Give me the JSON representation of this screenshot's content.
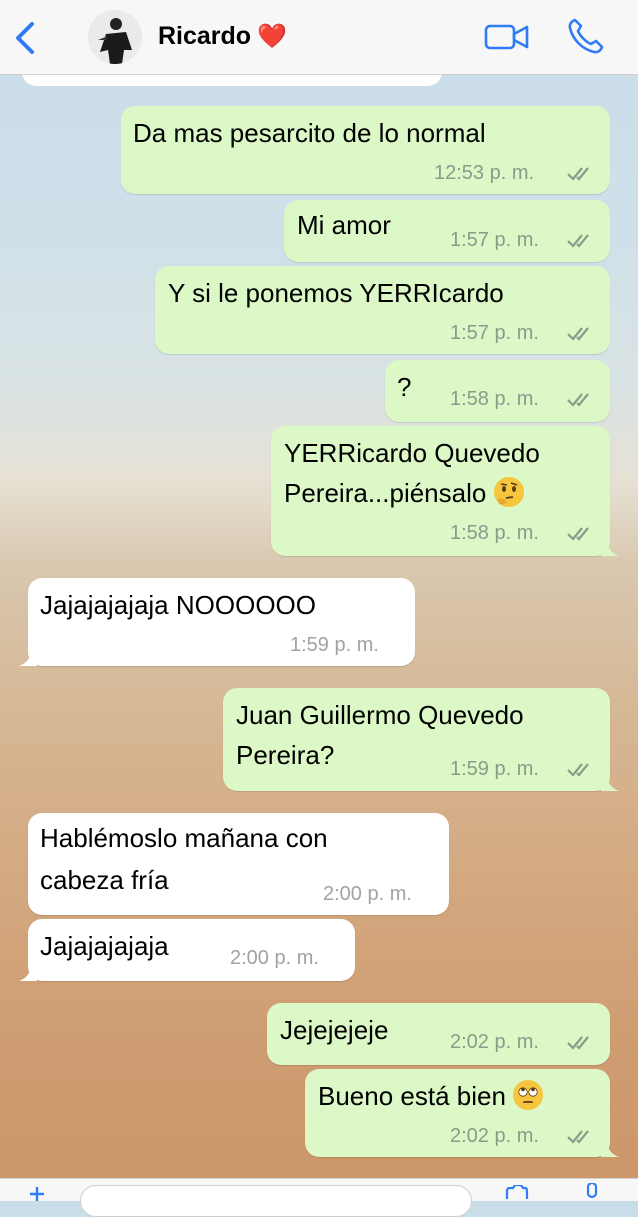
{
  "header": {
    "contact_name": "Ricardo",
    "heart": "❤️"
  },
  "messages": [
    {
      "direction": "out",
      "text": "Da mas pesarcito de lo normal",
      "time": "12:53 p. m.",
      "status": "read"
    },
    {
      "direction": "out",
      "text": "Mi amor",
      "time": "1:57 p. m.",
      "status": "read"
    },
    {
      "direction": "out",
      "text": "Y si le ponemos YERRIcardo",
      "time": "1:57 p. m.",
      "status": "read"
    },
    {
      "direction": "out",
      "text": "?",
      "time": "1:58 p. m.",
      "status": "read"
    },
    {
      "direction": "out",
      "line1": "YERRicardo Quevedo",
      "line2": "Pereira...piénsalo",
      "emoji": "thinking-face",
      "time": "1:58 p. m.",
      "status": "read"
    },
    {
      "direction": "in",
      "text": "Jajajajajaja NOOOOOO",
      "time": "1:59 p. m."
    },
    {
      "direction": "out",
      "line1": "Juan Guillermo Quevedo",
      "line2": "Pereira?",
      "time": "1:59 p. m.",
      "status": "read"
    },
    {
      "direction": "in",
      "line1": "Hablémoslo mañana con",
      "line2": "cabeza fría",
      "time": "2:00 p. m."
    },
    {
      "direction": "in",
      "text": "Jajajajajaja",
      "time": "2:00 p. m."
    },
    {
      "direction": "out",
      "text": "Jejejejeje",
      "time": "2:02 p. m.",
      "status": "read"
    },
    {
      "direction": "out",
      "text": "Bueno está bien",
      "emoji": "face-with-rolling-eyes",
      "time": "2:02 p. m.",
      "status": "read"
    }
  ],
  "colors": {
    "outgoing_bubble": "#dcf8c6",
    "incoming_bubble": "#ffffff",
    "accent": "#2f7cf6",
    "read_ticks": "#8d9a8a"
  }
}
